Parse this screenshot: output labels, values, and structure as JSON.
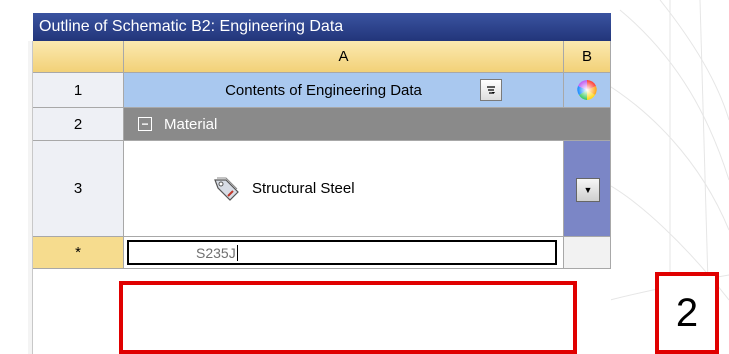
{
  "panel": {
    "title": "Outline of Schematic B2: Engineering Data"
  },
  "columns": [
    {
      "label": "A"
    },
    {
      "label": "B"
    }
  ],
  "rows": [
    {
      "num": "1",
      "label": "Contents of Engineering Data",
      "sort_icon": "sort-icon",
      "color_icon": "color-wheel-icon"
    },
    {
      "num": "2",
      "label": "Material",
      "toggle": "−"
    },
    {
      "num": "3",
      "label": "Structural Steel",
      "icon": "material-tag-icon",
      "dropdown_icon": "chevron-down-icon"
    },
    {
      "num": "*",
      "input_value": "S235J"
    }
  ],
  "annotation": {
    "label": "2",
    "color": "#e00000"
  },
  "colors": {
    "title_bar": "#2c3f8a",
    "header_row": "#f2d178",
    "row1": "#a9c8ef",
    "row2": "#8a8a8a",
    "dropdown_cell": "#7b86c6",
    "new_row": "#f6dc8e"
  }
}
